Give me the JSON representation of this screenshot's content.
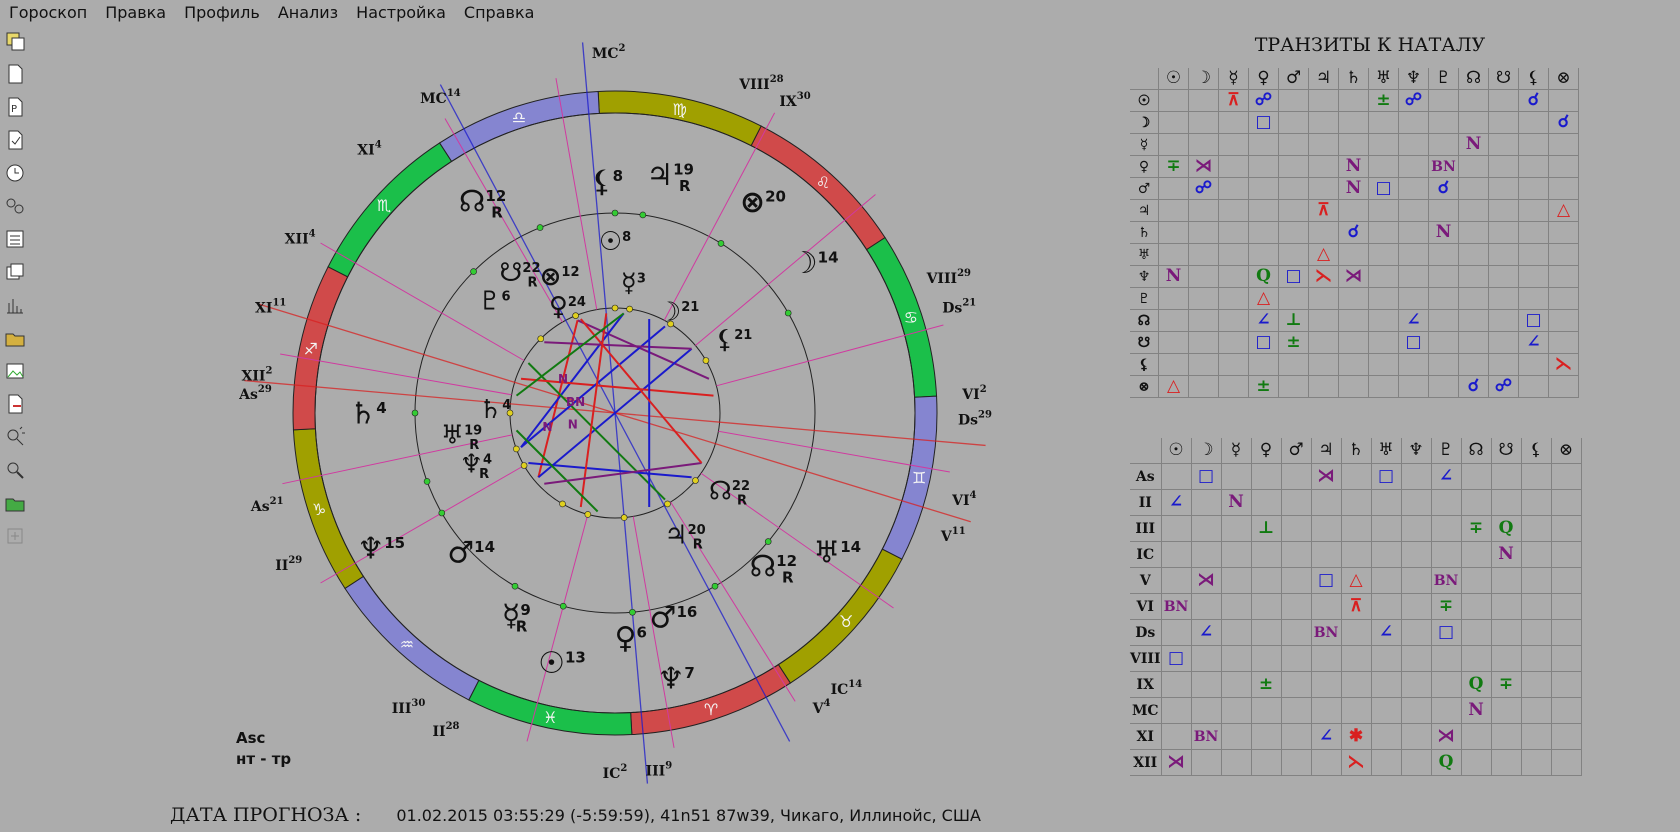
{
  "menu": [
    "Гороскоп",
    "Правка",
    "Профиль",
    "Анализ",
    "Настройка",
    "Справка"
  ],
  "colors": {
    "background": "#acacac",
    "red": "#d92020",
    "blue": "#1a1acc",
    "green": "#117a11",
    "purple": "#7a1a7a",
    "zodiac_olive": "#a0a000",
    "zodiac_red": "#d04a4a",
    "zodiac_green": "#1bbf4a",
    "zodiac_violet": "#8585d0"
  },
  "toolbar": [
    "horoscopes-icon",
    "new-file-icon",
    "profile-icon",
    "checklist-icon",
    "clock-icon",
    "compare-icon",
    "list-icon",
    "windows-icon",
    "bar-chart-icon",
    "folder-icon",
    "image-icon",
    "export-icon",
    "magnifier-rays-icon",
    "magnifier-icon",
    "open-folder-icon",
    "add-icon"
  ],
  "chart": {
    "signs": [
      "♈",
      "♉",
      "♊",
      "♋",
      "♌",
      "♍",
      "♎",
      "♏",
      "♐",
      "♑",
      "♒",
      "♓"
    ],
    "outer_labels": [
      {
        "text": "MC",
        "sup": "2"
      },
      {
        "text": "MC",
        "sup": "14"
      },
      {
        "text": "XI",
        "sup": "4"
      },
      {
        "text": "XII",
        "sup": "4"
      },
      {
        "text": "XI",
        "sup": "11"
      },
      {
        "text": "XII",
        "sup": "2"
      },
      {
        "text": "As",
        "sup": "29"
      },
      {
        "text": "As",
        "sup": "21"
      },
      {
        "text": "II",
        "sup": "29"
      },
      {
        "text": "III",
        "sup": "30"
      },
      {
        "text": "II",
        "sup": "28"
      },
      {
        "text": "IC",
        "sup": "2"
      },
      {
        "text": "III",
        "sup": "9"
      },
      {
        "text": "V",
        "sup": "4"
      },
      {
        "text": "IC",
        "sup": "14"
      },
      {
        "text": "V",
        "sup": "11"
      },
      {
        "text": "VI",
        "sup": "4"
      },
      {
        "text": "Ds",
        "sup": "29"
      },
      {
        "text": "VI",
        "sup": "2"
      },
      {
        "text": "Ds",
        "sup": "21"
      },
      {
        "text": "VIII",
        "sup": "29"
      },
      {
        "text": "IX",
        "sup": "30"
      },
      {
        "text": "VIII",
        "sup": "28"
      }
    ],
    "transit_planets": [
      {
        "g": "⚸",
        "deg": "8",
        "r": ""
      },
      {
        "g": "♃",
        "deg": "19",
        "r": "R"
      },
      {
        "g": "⊗",
        "deg": "20",
        "r": ""
      },
      {
        "g": "☽",
        "deg": "14",
        "r": ""
      },
      {
        "g": "☊",
        "deg": "12",
        "r": "R"
      },
      {
        "g": "♄",
        "deg": "4",
        "r": ""
      },
      {
        "g": "♂",
        "deg": "14",
        "r": ""
      },
      {
        "g": "♆",
        "deg": "15",
        "r": ""
      },
      {
        "g": "☿",
        "deg": "9",
        "r": "R"
      },
      {
        "g": "☉",
        "deg": "13",
        "r": ""
      },
      {
        "g": "♀",
        "deg": "6",
        "r": ""
      },
      {
        "g": "♂",
        "deg": "16",
        "r": ""
      },
      {
        "g": "♆",
        "deg": "7",
        "r": ""
      },
      {
        "g": "☊",
        "deg": "12",
        "r": "R"
      },
      {
        "g": "♅",
        "deg": "14",
        "r": ""
      }
    ],
    "natal_planets": [
      {
        "g": "☉",
        "deg": "8",
        "r": ""
      },
      {
        "g": "☿",
        "deg": "3",
        "r": ""
      },
      {
        "g": "☋",
        "deg": "22",
        "r": "R"
      },
      {
        "g": "⊗",
        "deg": "12",
        "r": ""
      },
      {
        "g": "♇",
        "deg": "6",
        "r": ""
      },
      {
        "g": "♀",
        "deg": "24",
        "r": ""
      },
      {
        "g": "☽",
        "deg": "21",
        "r": ""
      },
      {
        "g": "⚸",
        "deg": "21",
        "r": ""
      },
      {
        "g": "♄",
        "deg": "4",
        "r": ""
      },
      {
        "g": "♅",
        "deg": "19",
        "r": "R"
      },
      {
        "g": "♆",
        "deg": "4",
        "r": "R"
      },
      {
        "g": "☊",
        "deg": "22",
        "r": "R"
      },
      {
        "g": "♃",
        "deg": "20",
        "r": "R"
      }
    ],
    "small_aspect_marks": [
      "N",
      "BN",
      "N",
      "N"
    ],
    "footnote": [
      "Asc",
      "нт - тр"
    ]
  },
  "forecast": {
    "label": "ДАТА ПРОГНОЗА :",
    "value": "01.02.2015 03:55:29 (-5:59:59), 41n51 87w39, Чикаго, Иллинойс, США"
  },
  "transits_title": "ТРАНЗИТЫ  К НАТАЛУ",
  "grid1": {
    "cols": [
      "☉",
      "☽",
      "☿",
      "♀",
      "♂",
      "♃",
      "♄",
      "♅",
      "♆",
      "♇",
      "☊",
      "☋",
      "⚸",
      "⊗"
    ],
    "rows": [
      {
        "label": "☉",
        "cells": [
          "",
          "",
          "⊼",
          "☍",
          "",
          "",
          "",
          "±",
          "☍",
          "",
          "",
          "",
          "☌",
          ""
        ]
      },
      {
        "label": "☽",
        "cells": [
          "",
          "",
          "",
          "□",
          "",
          "",
          "",
          "",
          "",
          "",
          "",
          "",
          "",
          "☌"
        ]
      },
      {
        "label": "☿",
        "cells": [
          "",
          "",
          "",
          "",
          "",
          "",
          "",
          "",
          "",
          "",
          "N",
          "",
          "",
          ""
        ]
      },
      {
        "label": "♀",
        "cells": [
          "∓",
          "⋊",
          "",
          "",
          "",
          "",
          "N",
          "",
          "",
          "BN",
          "",
          "",
          "",
          ""
        ]
      },
      {
        "label": "♂",
        "cells": [
          "",
          "☍",
          "",
          "",
          "",
          "",
          "N",
          "□",
          "",
          "☌",
          "",
          "",
          "",
          ""
        ]
      },
      {
        "label": "♃",
        "cells": [
          "",
          "",
          "",
          "",
          "",
          "⊼",
          "",
          "",
          "",
          "",
          "",
          "",
          "",
          "△"
        ]
      },
      {
        "label": "♄",
        "cells": [
          "",
          "",
          "",
          "",
          "",
          "",
          "☌",
          "",
          "",
          "N",
          "",
          "",
          "",
          ""
        ]
      },
      {
        "label": "♅",
        "cells": [
          "",
          "",
          "",
          "",
          "",
          "△",
          "",
          "",
          "",
          "",
          "",
          "",
          "",
          ""
        ]
      },
      {
        "label": "♆",
        "cells": [
          "N",
          "",
          "",
          "Q",
          "□",
          "⋋",
          "⋊",
          "",
          "",
          "",
          "",
          "",
          "",
          ""
        ]
      },
      {
        "label": "♇",
        "cells": [
          "",
          "",
          "",
          "△",
          "",
          "",
          "",
          "",
          "",
          "",
          "",
          "",
          "",
          ""
        ]
      },
      {
        "label": "☊",
        "cells": [
          "",
          "",
          "",
          "∠",
          "⊥",
          "",
          "",
          "",
          "∠",
          "",
          "",
          "",
          "□",
          ""
        ]
      },
      {
        "label": "☋",
        "cells": [
          "",
          "",
          "",
          "□",
          "±",
          "",
          "",
          "",
          "□",
          "",
          "",
          "",
          "∠",
          ""
        ]
      },
      {
        "label": "⚸",
        "cells": [
          "",
          "",
          "",
          "",
          "",
          "",
          "",
          "",
          "",
          "",
          "",
          "",
          "",
          "⋋"
        ]
      },
      {
        "label": "⊗",
        "cells": [
          "△",
          "",
          "",
          "±",
          "",
          "",
          "",
          "",
          "",
          "",
          "☌",
          "☍",
          "",
          ""
        ]
      }
    ]
  },
  "grid2": {
    "cols": [
      "☉",
      "☽",
      "☿",
      "♀",
      "♂",
      "♃",
      "♄",
      "♅",
      "♆",
      "♇",
      "☊",
      "☋",
      "⚸",
      "⊗"
    ],
    "rows": [
      {
        "label": "As",
        "cells": [
          "",
          "□",
          "",
          "",
          "",
          "⋊",
          "",
          "□",
          "",
          "∠",
          "",
          "",
          "",
          ""
        ]
      },
      {
        "label": "II",
        "cells": [
          "∠",
          "",
          "N",
          "",
          "",
          "",
          "",
          "",
          "",
          "",
          "",
          "",
          "",
          ""
        ]
      },
      {
        "label": "III",
        "cells": [
          "",
          "",
          "",
          "⊥",
          "",
          "",
          "",
          "",
          "",
          "",
          "∓",
          "Q",
          "",
          ""
        ]
      },
      {
        "label": "IC",
        "cells": [
          "",
          "",
          "",
          "",
          "",
          "",
          "",
          "",
          "",
          "",
          "",
          "N",
          "",
          ""
        ]
      },
      {
        "label": "V",
        "cells": [
          "",
          "⋊",
          "",
          "",
          "",
          "□",
          "△",
          "",
          "",
          "BN",
          "",
          "",
          "",
          ""
        ]
      },
      {
        "label": "VI",
        "cells": [
          "BN",
          "",
          "",
          "",
          "",
          "",
          "⊼",
          "",
          "",
          "∓",
          "",
          "",
          "",
          ""
        ]
      },
      {
        "label": "Ds",
        "cells": [
          "",
          "∠",
          "",
          "",
          "",
          "BN",
          "",
          "∠",
          "",
          "□",
          "",
          "",
          "",
          ""
        ]
      },
      {
        "label": "VIII",
        "cells": [
          "□",
          "",
          "",
          "",
          "",
          "",
          "",
          "",
          "",
          "",
          "",
          "",
          "",
          ""
        ]
      },
      {
        "label": "IX",
        "cells": [
          "",
          "",
          "",
          "±",
          "",
          "",
          "",
          "",
          "",
          "",
          "Q",
          "∓",
          "",
          ""
        ]
      },
      {
        "label": "MC",
        "cells": [
          "",
          "",
          "",
          "",
          "",
          "",
          "",
          "",
          "",
          "",
          "N",
          "",
          "",
          ""
        ]
      },
      {
        "label": "XI",
        "cells": [
          "",
          "BN",
          "",
          "",
          "",
          "∠",
          "✱",
          "",
          "",
          "⋊",
          "",
          "",
          "",
          ""
        ]
      },
      {
        "label": "XII",
        "cells": [
          "⋊",
          "",
          "",
          "",
          "",
          "",
          "⋋",
          "",
          "",
          "Q",
          "",
          "",
          "",
          ""
        ]
      }
    ]
  }
}
